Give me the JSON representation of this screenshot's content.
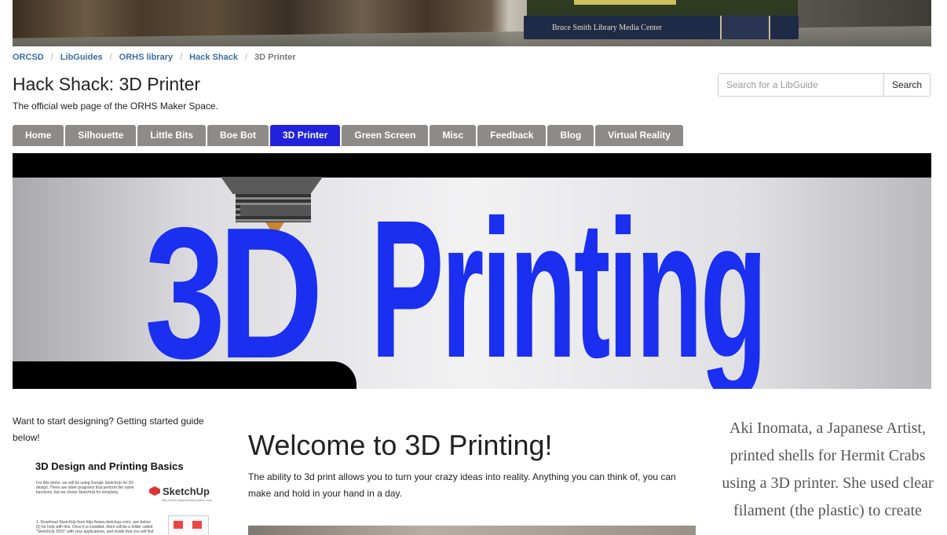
{
  "banner": {
    "book_spine": "Bruce Smith Library Media Center"
  },
  "breadcrumb": [
    {
      "label": "ORCSD",
      "link": true
    },
    {
      "label": "LibGuides",
      "link": true
    },
    {
      "label": "ORHS library",
      "link": true
    },
    {
      "label": "Hack Shack",
      "link": true
    },
    {
      "label": "3D Printer",
      "link": false
    }
  ],
  "header": {
    "title": "Hack Shack: 3D Printer",
    "subtitle": "The official web page of the ORHS Maker Space."
  },
  "search": {
    "placeholder": "Search for a LibGuide",
    "button_label": "Search"
  },
  "tabs": [
    {
      "label": "Home",
      "active": false
    },
    {
      "label": "Silhouette",
      "active": false
    },
    {
      "label": "Little Bits",
      "active": false
    },
    {
      "label": "Boe Bot",
      "active": false
    },
    {
      "label": "3D Printer",
      "active": true
    },
    {
      "label": "Green Screen",
      "active": false
    },
    {
      "label": "Misc",
      "active": false
    },
    {
      "label": "Feedback",
      "active": false
    },
    {
      "label": "Blog",
      "active": false
    },
    {
      "label": "Virtual Reality",
      "active": false
    }
  ],
  "hero": {
    "text_3d": "3D",
    "text_printing": "Printing"
  },
  "left": {
    "intro": "Want to start designing? Getting started guide below!",
    "doc_title": "3D Design and Printing Basics",
    "doc_text": "For this demo, we will be using Google SketchUp for 3D design. There are other programs that perform the same functions, but we chose SketchUp for simplicity.",
    "doc_logo": "SketchUp",
    "doc_logo_sub": "http://www.ontarionvationcation.com",
    "doc_step": "1. Download SketchUp from http://www.sketchup.com/, see below [1] for help with this. Once it is installed, there will be a folder called \"SketchUp 2015\" with your applications, and inside that you will find"
  },
  "main": {
    "heading": "Welcome to 3D Printing!",
    "paragraph": "The ability to 3d print allows you to turn your crazy ideas into reality. Anything you can think of, you can make and hold in your hand in a day."
  },
  "right": {
    "quote": "Aki Inomata, a Japanese Artist, printed shells for Hermit Crabs using a 3D printer. She used clear filament (the plastic) to create"
  },
  "colors": {
    "active_tab": "#2222dd",
    "tab": "#8e8a88",
    "hero_text": "#1a2ff0",
    "link": "#3a6ea5"
  }
}
